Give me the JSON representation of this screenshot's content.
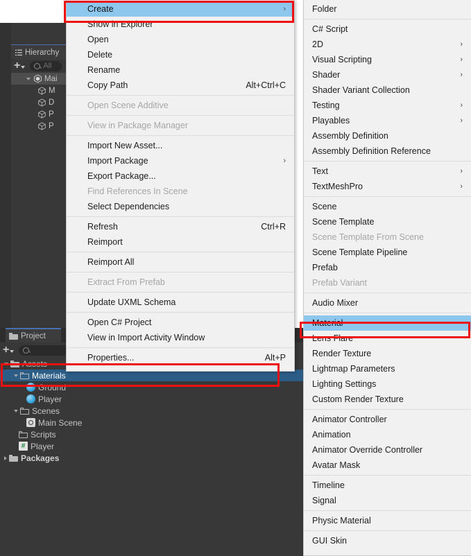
{
  "app": "Unity Editor",
  "hierarchy": {
    "tab_label": "Hierarchy",
    "tab_icon": "hierarchy-icon",
    "add_label": "+",
    "search_placeholder": "All",
    "items": [
      {
        "label": "Mai",
        "icon": "unity-scene-icon",
        "indent": 1,
        "expanded": true,
        "selected": true
      },
      {
        "label": "M",
        "icon": "cube-icon",
        "indent": 2,
        "expanded": false,
        "selected": false
      },
      {
        "label": "D",
        "icon": "cube-icon",
        "indent": 2,
        "expanded": false,
        "selected": false
      },
      {
        "label": "P",
        "icon": "cube-icon",
        "indent": 2,
        "expanded": false,
        "selected": false
      },
      {
        "label": "P",
        "icon": "cube-icon",
        "indent": 2,
        "expanded": false,
        "selected": false
      }
    ]
  },
  "project": {
    "tab_label": "Project",
    "tab_icon": "folder-icon",
    "add_label": "+",
    "search_placeholder": "",
    "tree": [
      {
        "label": "Assets",
        "icon": "folder-filled-icon",
        "indent": 0,
        "twisty": "open",
        "selected": false,
        "bold": false
      },
      {
        "label": "Materials",
        "icon": "folder-icon",
        "indent": 1,
        "twisty": "open",
        "selected": true,
        "bold": false
      },
      {
        "label": "Ground",
        "icon": "material-icon",
        "indent": 2,
        "twisty": "none",
        "selected": false,
        "bold": false
      },
      {
        "label": "Player",
        "icon": "material-icon",
        "indent": 2,
        "twisty": "none",
        "selected": false,
        "bold": false
      },
      {
        "label": "Scenes",
        "icon": "folder-icon",
        "indent": 1,
        "twisty": "open",
        "selected": false,
        "bold": false
      },
      {
        "label": "Main Scene",
        "icon": "scene-icon",
        "indent": 2,
        "twisty": "none",
        "selected": false,
        "bold": false
      },
      {
        "label": "Scripts",
        "icon": "folder-icon",
        "indent": 1,
        "twisty": "none",
        "selected": false,
        "bold": false
      },
      {
        "label": "Player",
        "icon": "csharp-script-icon",
        "indent": 1,
        "twisty": "none",
        "selected": false,
        "bold": false
      },
      {
        "label": "Packages",
        "icon": "folder-filled-icon",
        "indent": 0,
        "twisty": "closed",
        "selected": false,
        "bold": true
      }
    ]
  },
  "context_menu": {
    "items": [
      {
        "label": "Create",
        "shortcut": "",
        "submenu": true,
        "disabled": false,
        "highlighted": true
      },
      {
        "label": "Show in Explorer",
        "shortcut": "",
        "submenu": false,
        "disabled": false,
        "highlighted": false
      },
      {
        "label": "Open",
        "shortcut": "",
        "submenu": false,
        "disabled": false,
        "highlighted": false
      },
      {
        "label": "Delete",
        "shortcut": "",
        "submenu": false,
        "disabled": false,
        "highlighted": false
      },
      {
        "label": "Rename",
        "shortcut": "",
        "submenu": false,
        "disabled": false,
        "highlighted": false
      },
      {
        "label": "Copy Path",
        "shortcut": "Alt+Ctrl+C",
        "submenu": false,
        "disabled": false,
        "highlighted": false
      },
      {
        "separator": true
      },
      {
        "label": "Open Scene Additive",
        "shortcut": "",
        "submenu": false,
        "disabled": true,
        "highlighted": false
      },
      {
        "separator": true
      },
      {
        "label": "View in Package Manager",
        "shortcut": "",
        "submenu": false,
        "disabled": true,
        "highlighted": false
      },
      {
        "separator": true
      },
      {
        "label": "Import New Asset...",
        "shortcut": "",
        "submenu": false,
        "disabled": false,
        "highlighted": false
      },
      {
        "label": "Import Package",
        "shortcut": "",
        "submenu": true,
        "disabled": false,
        "highlighted": false
      },
      {
        "label": "Export Package...",
        "shortcut": "",
        "submenu": false,
        "disabled": false,
        "highlighted": false
      },
      {
        "label": "Find References In Scene",
        "shortcut": "",
        "submenu": false,
        "disabled": true,
        "highlighted": false
      },
      {
        "label": "Select Dependencies",
        "shortcut": "",
        "submenu": false,
        "disabled": false,
        "highlighted": false
      },
      {
        "separator": true
      },
      {
        "label": "Refresh",
        "shortcut": "Ctrl+R",
        "submenu": false,
        "disabled": false,
        "highlighted": false
      },
      {
        "label": "Reimport",
        "shortcut": "",
        "submenu": false,
        "disabled": false,
        "highlighted": false
      },
      {
        "separator": true
      },
      {
        "label": "Reimport All",
        "shortcut": "",
        "submenu": false,
        "disabled": false,
        "highlighted": false
      },
      {
        "separator": true
      },
      {
        "label": "Extract From Prefab",
        "shortcut": "",
        "submenu": false,
        "disabled": true,
        "highlighted": false
      },
      {
        "separator": true
      },
      {
        "label": "Update UXML Schema",
        "shortcut": "",
        "submenu": false,
        "disabled": false,
        "highlighted": false
      },
      {
        "separator": true
      },
      {
        "label": "Open C# Project",
        "shortcut": "",
        "submenu": false,
        "disabled": false,
        "highlighted": false
      },
      {
        "label": "View in Import Activity Window",
        "shortcut": "",
        "submenu": false,
        "disabled": false,
        "highlighted": false
      },
      {
        "separator": true
      },
      {
        "label": "Properties...",
        "shortcut": "Alt+P",
        "submenu": false,
        "disabled": false,
        "highlighted": false
      }
    ]
  },
  "create_submenu": {
    "items": [
      {
        "label": "Folder",
        "submenu": false,
        "disabled": false,
        "highlighted": false
      },
      {
        "separator": true
      },
      {
        "label": "C# Script",
        "submenu": false,
        "disabled": false,
        "highlighted": false
      },
      {
        "label": "2D",
        "submenu": true,
        "disabled": false,
        "highlighted": false
      },
      {
        "label": "Visual Scripting",
        "submenu": true,
        "disabled": false,
        "highlighted": false
      },
      {
        "label": "Shader",
        "submenu": true,
        "disabled": false,
        "highlighted": false
      },
      {
        "label": "Shader Variant Collection",
        "submenu": false,
        "disabled": false,
        "highlighted": false
      },
      {
        "label": "Testing",
        "submenu": true,
        "disabled": false,
        "highlighted": false
      },
      {
        "label": "Playables",
        "submenu": true,
        "disabled": false,
        "highlighted": false
      },
      {
        "label": "Assembly Definition",
        "submenu": false,
        "disabled": false,
        "highlighted": false
      },
      {
        "label": "Assembly Definition Reference",
        "submenu": false,
        "disabled": false,
        "highlighted": false
      },
      {
        "separator": true
      },
      {
        "label": "Text",
        "submenu": true,
        "disabled": false,
        "highlighted": false
      },
      {
        "label": "TextMeshPro",
        "submenu": true,
        "disabled": false,
        "highlighted": false
      },
      {
        "separator": true
      },
      {
        "label": "Scene",
        "submenu": false,
        "disabled": false,
        "highlighted": false
      },
      {
        "label": "Scene Template",
        "submenu": false,
        "disabled": false,
        "highlighted": false
      },
      {
        "label": "Scene Template From Scene",
        "submenu": false,
        "disabled": true,
        "highlighted": false
      },
      {
        "label": "Scene Template Pipeline",
        "submenu": false,
        "disabled": false,
        "highlighted": false
      },
      {
        "label": "Prefab",
        "submenu": false,
        "disabled": false,
        "highlighted": false
      },
      {
        "label": "Prefab Variant",
        "submenu": false,
        "disabled": true,
        "highlighted": false
      },
      {
        "separator": true
      },
      {
        "label": "Audio Mixer",
        "submenu": false,
        "disabled": false,
        "highlighted": false
      },
      {
        "separator": true
      },
      {
        "label": "Material",
        "submenu": false,
        "disabled": false,
        "highlighted": true
      },
      {
        "label": "Lens Flare",
        "submenu": false,
        "disabled": false,
        "highlighted": false
      },
      {
        "label": "Render Texture",
        "submenu": false,
        "disabled": false,
        "highlighted": false
      },
      {
        "label": "Lightmap Parameters",
        "submenu": false,
        "disabled": false,
        "highlighted": false
      },
      {
        "label": "Lighting Settings",
        "submenu": false,
        "disabled": false,
        "highlighted": false
      },
      {
        "label": "Custom Render Texture",
        "submenu": false,
        "disabled": false,
        "highlighted": false
      },
      {
        "separator": true
      },
      {
        "label": "Animator Controller",
        "submenu": false,
        "disabled": false,
        "highlighted": false
      },
      {
        "label": "Animation",
        "submenu": false,
        "disabled": false,
        "highlighted": false
      },
      {
        "label": "Animator Override Controller",
        "submenu": false,
        "disabled": false,
        "highlighted": false
      },
      {
        "label": "Avatar Mask",
        "submenu": false,
        "disabled": false,
        "highlighted": false
      },
      {
        "separator": true
      },
      {
        "label": "Timeline",
        "submenu": false,
        "disabled": false,
        "highlighted": false
      },
      {
        "label": "Signal",
        "submenu": false,
        "disabled": false,
        "highlighted": false
      },
      {
        "separator": true
      },
      {
        "label": "Physic Material",
        "submenu": false,
        "disabled": false,
        "highlighted": false
      },
      {
        "separator": true
      },
      {
        "label": "GUI Skin",
        "submenu": false,
        "disabled": false,
        "highlighted": false
      }
    ]
  },
  "annotations": {
    "color": "#ee1111",
    "boxes": [
      "create-menu-item",
      "material-menu-item",
      "materials-project-row"
    ]
  },
  "colors": {
    "menu_background": "#f1f1f1",
    "menu_highlight": "#8ec7ee",
    "editor_background": "#383838",
    "project_selection": "#2c5d87",
    "annotation_red": "#ee1111"
  }
}
